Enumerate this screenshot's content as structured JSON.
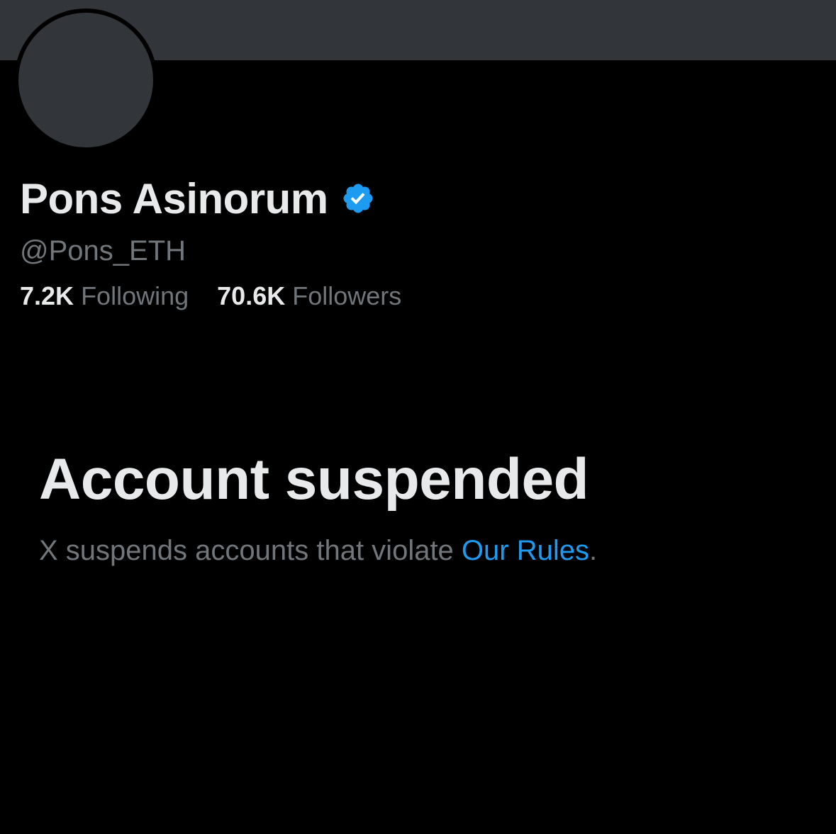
{
  "profile": {
    "display_name": "Pons Asinorum",
    "verified_icon": "verified-badge-icon",
    "handle": "@Pons_ETH",
    "following_count": "7.2K",
    "following_label": "Following",
    "followers_count": "70.6K",
    "followers_label": "Followers"
  },
  "suspension": {
    "title": "Account suspended",
    "description_prefix": "X suspends accounts that violate ",
    "rules_link": "Our Rules",
    "description_suffix": "."
  },
  "colors": {
    "background": "#000000",
    "banner": "#323539",
    "primary_text": "#e7e9ea",
    "secondary_text": "#71767b",
    "accent": "#1d9bf0"
  }
}
